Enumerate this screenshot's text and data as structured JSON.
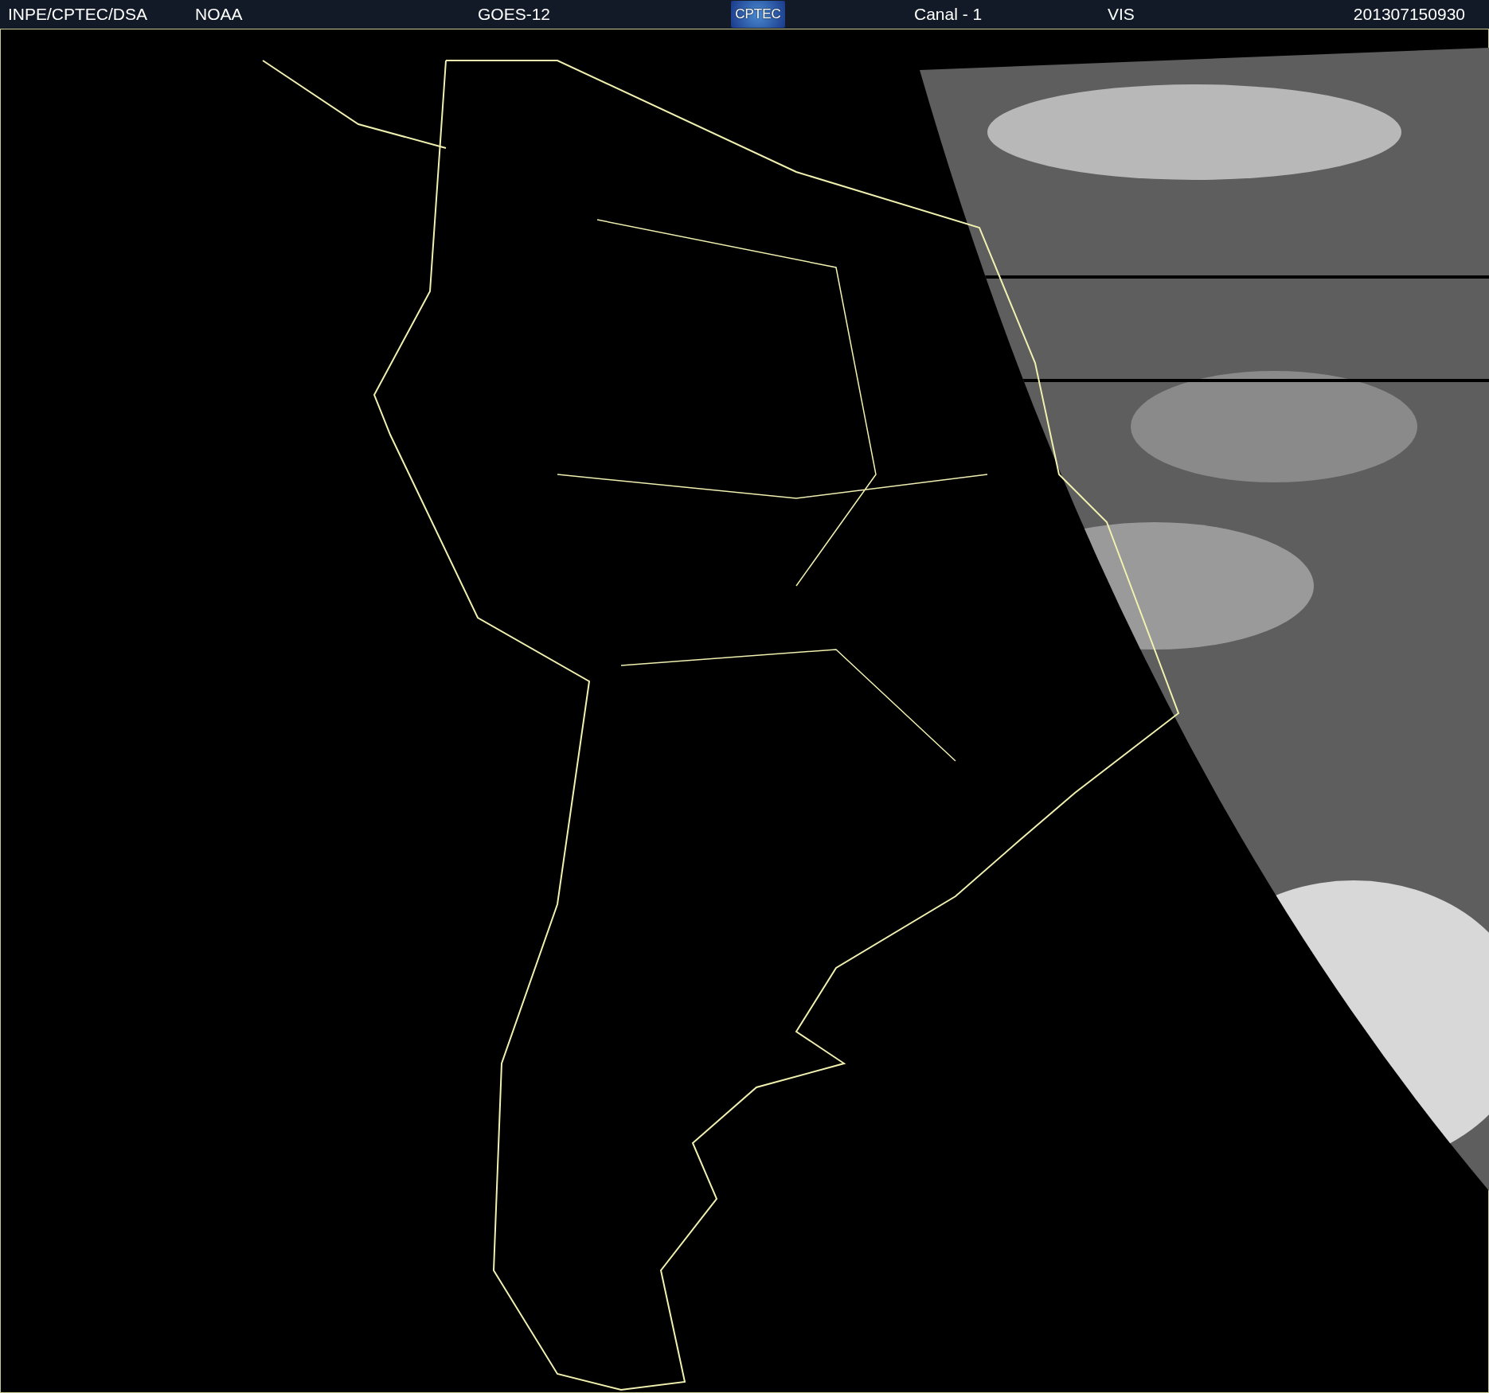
{
  "header": {
    "source": "INPE/CPTEC/DSA",
    "agency": "NOAA",
    "satellite": "GOES-12",
    "logo": "CPTEC",
    "channel": "Canal - 1",
    "band": "VIS",
    "timestamp": "201307150930"
  }
}
